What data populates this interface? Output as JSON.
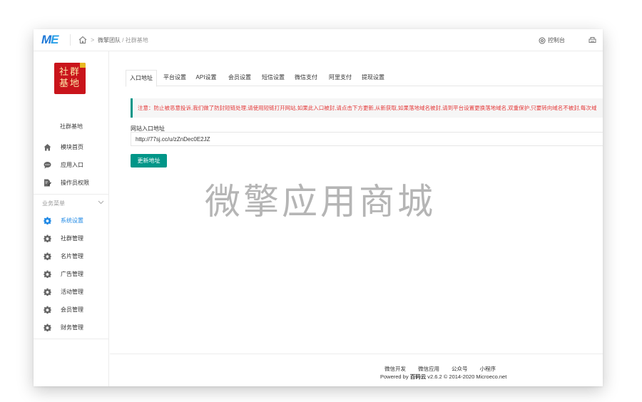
{
  "header": {
    "logo_main": "M",
    "logo_accent": "E",
    "breadcrumb": [
      "微擎团队",
      "社群基地"
    ],
    "breadcrumb_sep": "/",
    "control_label": "控制台"
  },
  "sidebar": {
    "avatar_line1": "社群",
    "avatar_line2": "基地",
    "site_name": "社群基地",
    "top_items": [
      {
        "label": "模块首页",
        "icon": "home-icon"
      },
      {
        "label": "应用入口",
        "icon": "chat-bubble-icon"
      },
      {
        "label": "操作员权限",
        "icon": "edit-document-icon"
      }
    ],
    "section_title": "业务菜单",
    "biz_items": [
      {
        "label": "系统设置",
        "icon": "gear-icon",
        "active": true
      },
      {
        "label": "社群管理",
        "icon": "gear-icon"
      },
      {
        "label": "名片管理",
        "icon": "gear-icon"
      },
      {
        "label": "广告管理",
        "icon": "gear-icon"
      },
      {
        "label": "活动管理",
        "icon": "gear-icon"
      },
      {
        "label": "会员管理",
        "icon": "gear-icon"
      },
      {
        "label": "财务管理",
        "icon": "gear-icon"
      }
    ]
  },
  "tabs": [
    {
      "label": "入口地址",
      "active": true
    },
    {
      "label": "平台设置"
    },
    {
      "label": "API设置"
    },
    {
      "label": "会员设置"
    },
    {
      "label": "短信设置"
    },
    {
      "label": "微信支付"
    },
    {
      "label": "阿里支付"
    },
    {
      "label": "提现设置"
    }
  ],
  "main": {
    "notice": "注意：防止被恶意投诉,我们做了防封短链处理,请使用短链打开网站,如果此入口被封,请点击下方更新,从新获取,如果落地域名被封,请到平台设置更换落地域名,双重保护,只要转向域名不被封,每次域",
    "field_label": "网站入口地址",
    "field_value": "http://77sj.cc/u/zZnDec0E2JZ",
    "update_button": "更新地址",
    "watermark": "微擎应用商城"
  },
  "footer": {
    "links": [
      "微信开发",
      "微信应用",
      "公众号",
      "小程序"
    ],
    "powered_prefix": "Powered by ",
    "brand": "百码云",
    "powered_suffix": " v2.6.2 © 2014-2020 Microeco.net"
  },
  "colors": {
    "accent": "#009688",
    "active_link": "#1e88e5",
    "notice_text": "#e43a3a",
    "logo": "#1e78d7"
  }
}
